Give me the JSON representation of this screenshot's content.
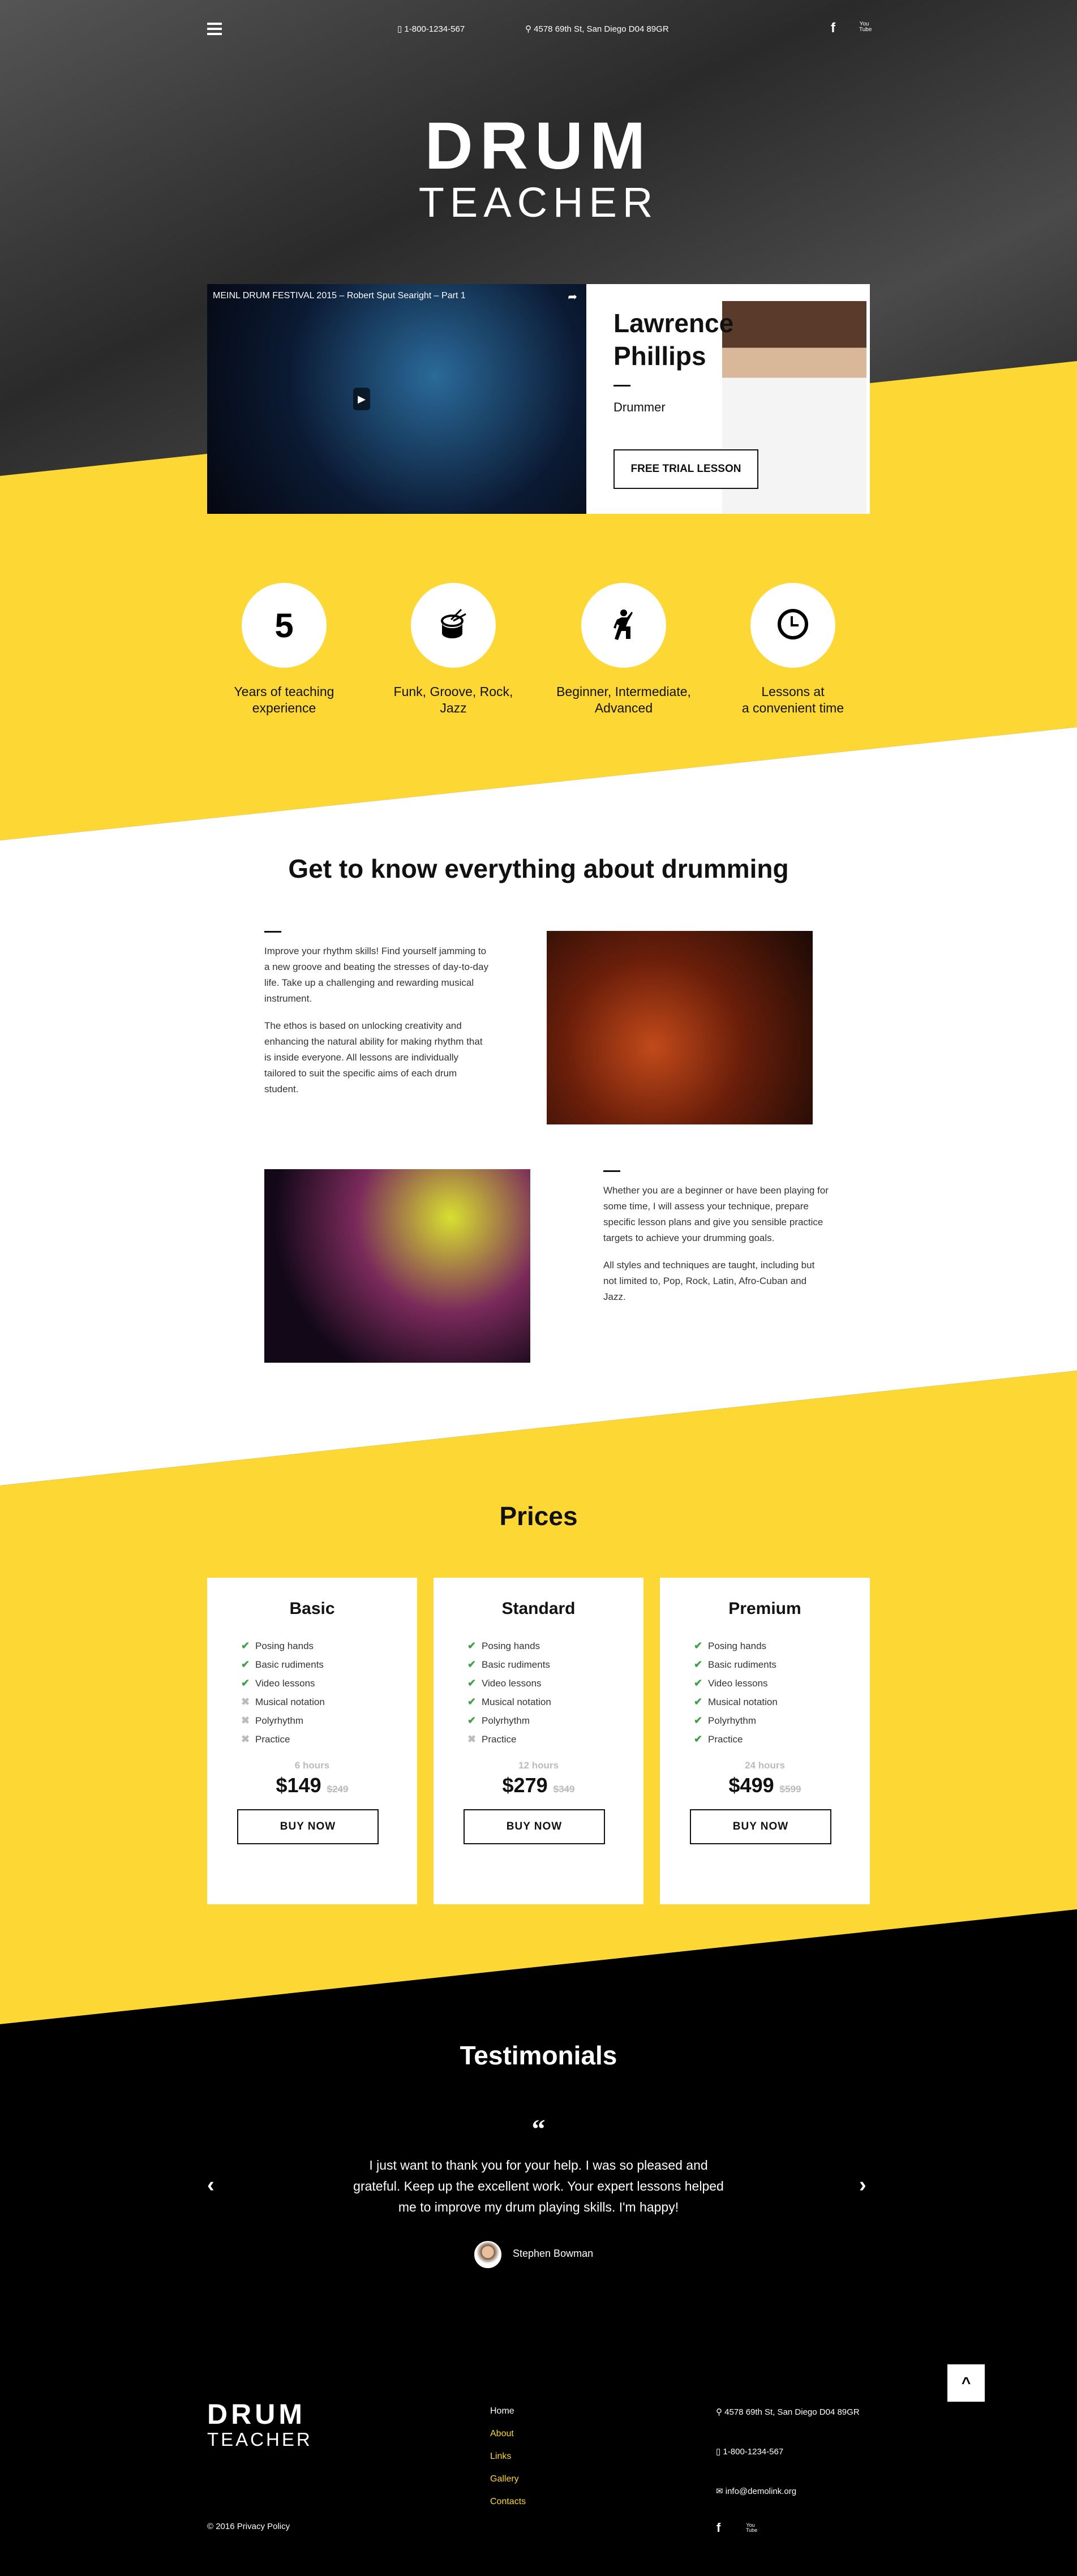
{
  "colors": {
    "accent": "#fdd835",
    "dark": "#000000",
    "check": "#43a047"
  },
  "topbar": {
    "menu_icon": "hamburger-icon",
    "phone": "1-800-1234-567",
    "address": "4578 69th St, San Diego D04 89GR",
    "social": [
      "facebook-icon",
      "youtube-icon"
    ]
  },
  "hero": {
    "title_line1": "DRUM",
    "title_line2": "TEACHER"
  },
  "video": {
    "title": "MEINL DRUM FESTIVAL 2015 – Robert Sput Searight – Part 1"
  },
  "teacher": {
    "name_line1": "Lawrence",
    "name_line2": "Phillips",
    "role": "Drummer",
    "cta": "FREE TRIAL LESSON"
  },
  "features": [
    {
      "icon": "number",
      "value": "5",
      "line1": "Years of teaching",
      "line2": "experience"
    },
    {
      "icon": "drum-icon",
      "line1": "Funk, Groove, Rock,",
      "line2": "Jazz"
    },
    {
      "icon": "stairs-climber-icon",
      "line1": "Beginner, Intermediate,",
      "line2": "Advanced"
    },
    {
      "icon": "clock-icon",
      "line1": "Lessons at",
      "line2": "a convenient time"
    }
  ],
  "about": {
    "title": "Get to know everything about drumming",
    "block1": [
      "Improve your rhythm skills! Find yourself jamming to a new groove and beating the stresses of day-to-day life. Take up a challenging and rewarding musical instrument.",
      "The ethos is based on unlocking creativity and enhancing the natural ability for making rhythm that is inside everyone. All lessons are individually tailored to suit the specific aims of each drum student."
    ],
    "block2": [
      "Whether you are a beginner or have been playing for some time, I will assess your technique, prepare specific lesson plans and give you sensible practice targets to achieve your drumming goals.",
      "All styles and techniques are taught, including but not limited to, Pop, Rock, Latin, Afro-Cuban and Jazz."
    ]
  },
  "prices": {
    "title": "Prices",
    "plans": [
      {
        "name": "Basic",
        "hours": "6 hours",
        "price": "$149",
        "old_price": "$249",
        "button": "BUY NOW",
        "features": [
          {
            "label": "Posing hands",
            "included": true
          },
          {
            "label": "Basic rudiments",
            "included": true
          },
          {
            "label": "Video lessons",
            "included": true
          },
          {
            "label": "Musical notation",
            "included": false
          },
          {
            "label": "Polyrhythm",
            "included": false
          },
          {
            "label": "Practice",
            "included": false
          }
        ]
      },
      {
        "name": "Standard",
        "hours": "12 hours",
        "price": "$279",
        "old_price": "$349",
        "button": "BUY NOW",
        "features": [
          {
            "label": "Posing hands",
            "included": true
          },
          {
            "label": "Basic rudiments",
            "included": true
          },
          {
            "label": "Video lessons",
            "included": true
          },
          {
            "label": "Musical notation",
            "included": true
          },
          {
            "label": "Polyrhythm",
            "included": true
          },
          {
            "label": "Practice",
            "included": false
          }
        ]
      },
      {
        "name": "Premium",
        "hours": "24 hours",
        "price": "$499",
        "old_price": "$599",
        "button": "BUY NOW",
        "features": [
          {
            "label": "Posing hands",
            "included": true
          },
          {
            "label": "Basic rudiments",
            "included": true
          },
          {
            "label": "Video lessons",
            "included": true
          },
          {
            "label": "Musical notation",
            "included": true
          },
          {
            "label": "Polyrhythm",
            "included": true
          },
          {
            "label": "Practice",
            "included": true
          }
        ]
      }
    ]
  },
  "testimonials": {
    "title": "Testimonials",
    "quote": "I just want to thank you for your help. I was so pleased and grateful. Keep up the excellent work. Your expert lessons helped me to improve my drum playing skills. I'm happy!",
    "author": "Stephen Bowman"
  },
  "footer": {
    "logo_line1": "DRUM",
    "logo_line2": "TEACHER",
    "links": [
      "Home",
      "About",
      "Links",
      "Gallery",
      "Contacts"
    ],
    "address": "4578 69th St, San Diego D04 89GR",
    "phone": "1-800-1234-567",
    "email": "info@demolink.org",
    "copyright": "© 2016",
    "privacy": "Privacy Policy"
  }
}
